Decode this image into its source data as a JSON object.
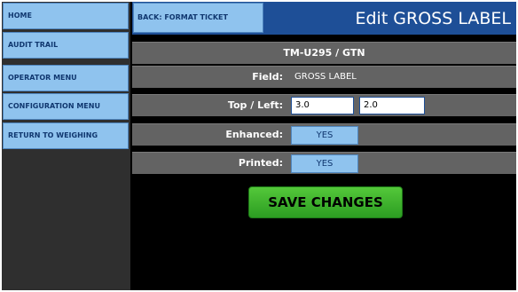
{
  "sidebar": {
    "items": [
      {
        "label": "HOME"
      },
      {
        "label": "AUDIT TRAIL"
      },
      {
        "label": "OPERATOR MENU"
      },
      {
        "label": "CONFIGURATION MENU"
      },
      {
        "label": "RETURN TO WEIGHING"
      }
    ]
  },
  "header": {
    "back_label": "BACK: FORMAT TICKET",
    "title": "Edit GROSS LABEL"
  },
  "form": {
    "printer": "TM-U295 / GTN",
    "field_label": "Field:",
    "field_value": "GROSS LABEL",
    "top_left_label": "Top / Left:",
    "top_value": "3.0",
    "left_value": "2.0",
    "enhanced_label": "Enhanced:",
    "enhanced_value": "YES",
    "printed_label": "Printed:",
    "printed_value": "YES"
  },
  "actions": {
    "save_label": "SAVE CHANGES"
  },
  "colors": {
    "nav_button": "#8fc3ee",
    "header_bar": "#1e4f97",
    "row_background": "#636363",
    "save_button": "#3db52d"
  }
}
